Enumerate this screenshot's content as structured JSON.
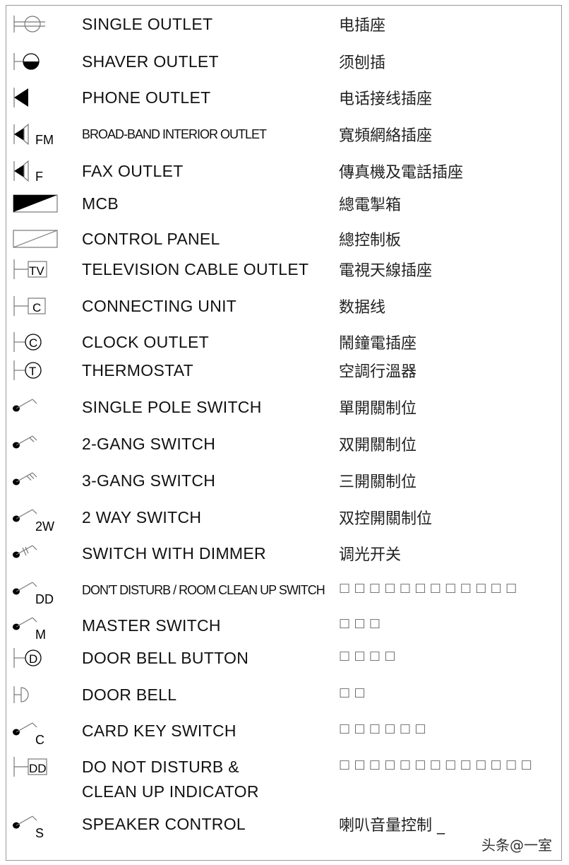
{
  "rows": [
    {
      "icon": "single-outlet-symbol",
      "en": "SINGLE OUTLET",
      "zh": "电插座"
    },
    {
      "icon": "shaver-outlet-symbol",
      "en": "SHAVER OUTLET",
      "zh": "须刨插"
    },
    {
      "icon": "phone-outlet-symbol",
      "en": "PHONE OUTLET",
      "zh": "电话接线插座"
    },
    {
      "icon": "broadband-outlet-symbol",
      "label": "FM",
      "en": "BROAD-BAND INTERIOR OUTLET",
      "zh": "寬頻網絡插座",
      "condensed": true
    },
    {
      "icon": "fax-outlet-symbol",
      "label": "F",
      "en": "FAX OUTLET",
      "zh": "傳真機及電話插座"
    },
    {
      "icon": "mcb-symbol",
      "en": "MCB",
      "zh": "總電掣箱"
    },
    {
      "icon": "control-panel-symbol",
      "en": "CONTROL PANEL",
      "zh": "總控制板"
    },
    {
      "icon": "boxed-symbol",
      "label": "TV",
      "en": "TELEVISION CABLE OUTLET",
      "zh": "電視天線插座"
    },
    {
      "icon": "boxed-symbol",
      "label": "C",
      "en": "CONNECTING UNIT",
      "zh": "数据线"
    },
    {
      "icon": "circled-symbol",
      "label": "C",
      "en": "CLOCK OUTLET",
      "zh": "鬧鐘電插座"
    },
    {
      "icon": "circled-symbol",
      "label": "T",
      "en": "THERMOSTAT",
      "zh": "空調行溫器"
    },
    {
      "icon": "switch-symbol",
      "gangs": 1,
      "en": "SINGLE POLE SWITCH",
      "zh": "單開關制位"
    },
    {
      "icon": "switch-symbol",
      "gangs": 2,
      "en": "2-GANG SWITCH",
      "zh": "双開關制位"
    },
    {
      "icon": "switch-symbol",
      "gangs": 3,
      "en": "3-GANG SWITCH",
      "zh": "三開關制位"
    },
    {
      "icon": "switch-symbol",
      "gangs": 1,
      "label": "2W",
      "en": "2 WAY SWITCH",
      "zh": "双控開關制位"
    },
    {
      "icon": "dimmer-switch-symbol",
      "en": "SWITCH WITH DIMMER",
      "zh": "调光开关"
    },
    {
      "icon": "switch-symbol",
      "gangs": 1,
      "label": "DD",
      "en": "DON'T DISTURB / ROOM CLEAN UP SWITCH",
      "zh": "□ □ □ □ □ □ □ □ □ □ □ □",
      "condensed": true
    },
    {
      "icon": "switch-symbol",
      "gangs": 1,
      "label": "M",
      "en": "MASTER SWITCH",
      "zh": "□ □ □"
    },
    {
      "icon": "circled-symbol",
      "label": "D",
      "en": "DOOR BELL BUTTON",
      "zh": "□ □ □ □"
    },
    {
      "icon": "door-bell-symbol",
      "en": "DOOR BELL",
      "zh": "□ □"
    },
    {
      "icon": "switch-symbol",
      "gangs": 1,
      "label": "C",
      "en": "CARD KEY SWITCH",
      "zh": "□ □ □ □ □ □"
    },
    {
      "icon": "boxed-symbol",
      "label": "DD",
      "en": "DO NOT DISTURB &",
      "en2": "CLEAN UP INDICATOR",
      "zh": "□ □ □ □ □ □ □ □ □ □ □ □ □"
    },
    {
      "icon": "switch-symbol",
      "gangs": 1,
      "label": "S",
      "en": "SPEAKER CONTROL",
      "zh": "喇叭音量控制 _"
    }
  ],
  "watermark": "头条@一室"
}
